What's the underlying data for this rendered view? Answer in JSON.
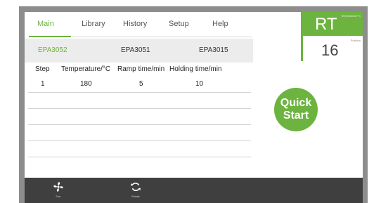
{
  "nav": {
    "tabs": [
      {
        "label": "Main",
        "active": true
      },
      {
        "label": "Library"
      },
      {
        "label": "History"
      },
      {
        "label": "Setup"
      },
      {
        "label": "Help"
      }
    ]
  },
  "programs": [
    {
      "label": "EPA3052",
      "active": true
    },
    {
      "label": "EPA3051"
    },
    {
      "label": "EPA3015"
    }
  ],
  "table": {
    "headers": [
      "Step",
      "Temperature/°C",
      "Ramp time/min",
      "Holding time/min"
    ],
    "rows": [
      [
        "1",
        "180",
        "5",
        "10"
      ]
    ]
  },
  "status": {
    "temperature_label": "Temperature/°C",
    "temperature_value": "RT",
    "position_label": "Position",
    "position_value": "16"
  },
  "quick_start_label": "Quick Start",
  "bottom_bar": {
    "fan_label": "Fan",
    "rotate_label": "Rotate"
  },
  "colors": {
    "accent": "#6cb33f",
    "bottom_bar": "#3f3f3f",
    "frame": "#8d8d8d"
  }
}
